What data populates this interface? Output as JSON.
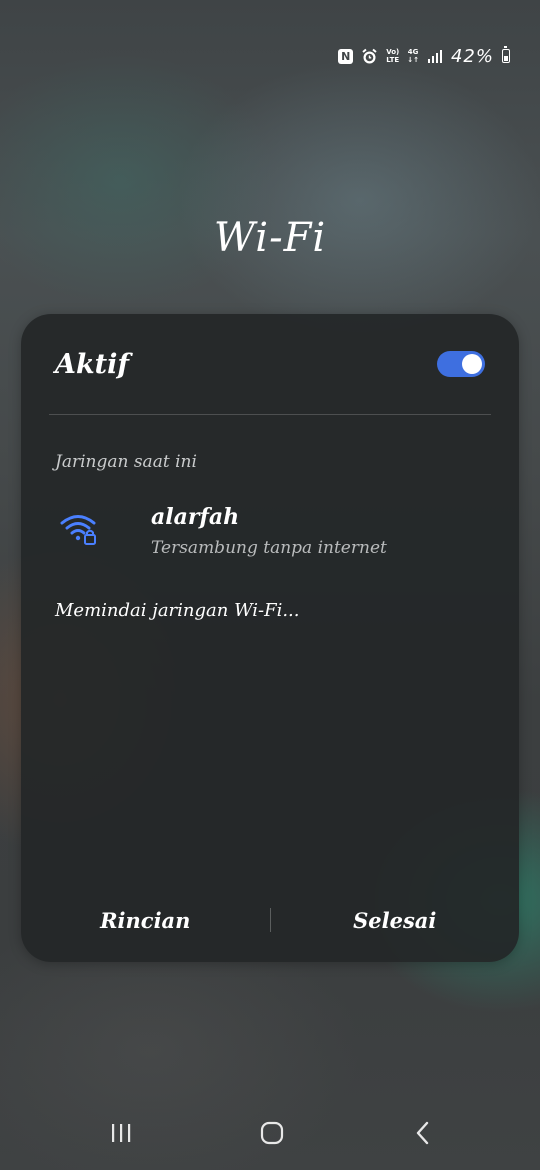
{
  "status_bar": {
    "nfc_glyph": "N",
    "volte_text": "Vo)\nLTE",
    "network_type": "4G\n↓↑",
    "battery_percent": "42%",
    "icons": [
      "nfc-icon",
      "alarm-icon",
      "volte-icon",
      "4g-icon",
      "signal-icon",
      "battery-icon"
    ]
  },
  "page": {
    "title": "Wi-Fi"
  },
  "card": {
    "toggle_label": "Aktif",
    "toggle_on": true,
    "current_network_header": "Jaringan saat ini",
    "network": {
      "name": "alarfah",
      "status": "Tersambung tanpa internet",
      "icon": "wifi-locked-icon"
    },
    "scanning_text": "Memindai jaringan Wi-Fi...",
    "details_label": "Rincian",
    "done_label": "Selesai"
  },
  "nav_bar": {
    "icons": [
      "recents-icon",
      "home-icon",
      "back-icon"
    ]
  },
  "colors": {
    "accent": "#3e6fe0",
    "card_bg": "#242728",
    "text_primary": "#ffffff",
    "text_secondary": "#b9bbbc"
  }
}
